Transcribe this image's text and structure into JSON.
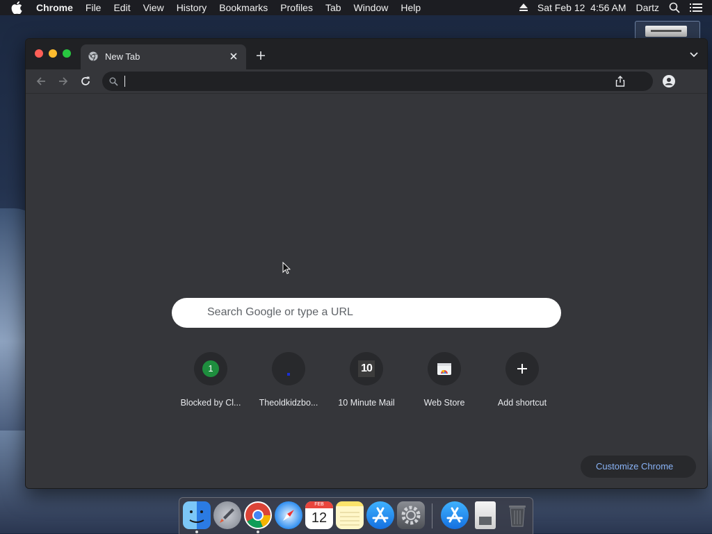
{
  "menubar": {
    "app": "Chrome",
    "items": [
      "File",
      "Edit",
      "View",
      "History",
      "Bookmarks",
      "Profiles",
      "Tab",
      "Window",
      "Help"
    ],
    "datetime": "Sat Feb 12  4:56 AM",
    "user": "Dartz"
  },
  "browser": {
    "tab": {
      "title": "New Tab"
    },
    "omnibox": {
      "value": ""
    }
  },
  "ntp": {
    "search_placeholder": "Search Google or type a URL",
    "shortcuts": [
      {
        "label": "Blocked by Cl...",
        "icon": "green-badge-1-icon",
        "badge": "1"
      },
      {
        "label": "Theoldkidzbo...",
        "icon": "blue-dot-favicon"
      },
      {
        "label": "10 Minute Mail",
        "icon": "ten-favicon",
        "badge": "10"
      },
      {
        "label": "Web Store",
        "icon": "web-store-icon"
      },
      {
        "label": "Add shortcut",
        "icon": "plus-icon"
      }
    ],
    "customize_label": "Customize Chrome"
  },
  "dock": {
    "apps": [
      "Finder",
      "Launchpad",
      "Google Chrome",
      "Safari",
      "Calendar",
      "Notes",
      "App Store",
      "System Preferences",
      "App Store Downloads",
      "Documents",
      "Trash"
    ],
    "calendar": {
      "month": "FEB",
      "day": "12"
    }
  },
  "colors": {
    "window_bg": "#35363a",
    "tabstrip_bg": "#202124",
    "accent_link": "#8ab4f8"
  }
}
